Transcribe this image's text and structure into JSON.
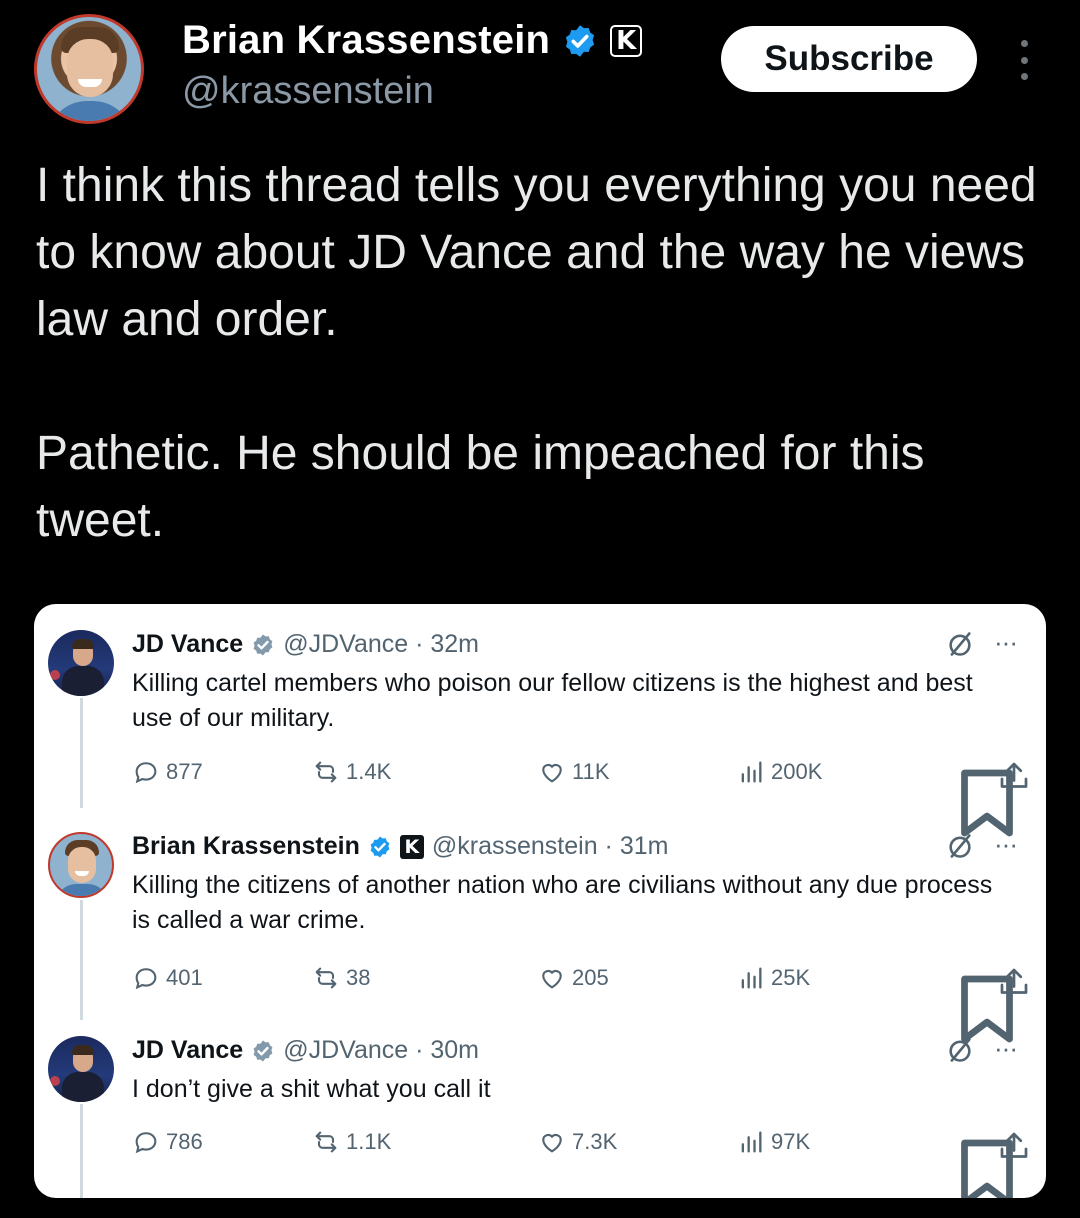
{
  "author": {
    "display_name": "Brian Krassenstein",
    "handle": "@krassenstein",
    "affiliate_badge": "K"
  },
  "subscribe_label": "Subscribe",
  "post": {
    "paragraph_1": "I think this thread tells you everything you need to know about JD Vance and the way he views law and order.",
    "paragraph_2": "Pathetic.  He should be impeached for this tweet."
  },
  "embedded_thread": {
    "tweets": [
      {
        "name": "JD Vance",
        "handle_time": "@JDVance · 32m",
        "text": "Killing cartel members who poison our fellow citizens is the highest and best use of our military.",
        "replies": "877",
        "retweets": "1.4K",
        "likes": "11K",
        "views": "200K"
      },
      {
        "name": "Brian Krassenstein",
        "badge": "K",
        "handle_time": "@krassenstein · 31m",
        "text": "Killing the citizens of another nation who are civilians without any due process is called a war crime.",
        "replies": "401",
        "retweets": "38",
        "likes": "205",
        "views": "25K"
      },
      {
        "name": "JD Vance",
        "handle_time": "@JDVance · 30m",
        "text": "I don’t give a shit what you call it",
        "replies": "786",
        "retweets": "1.1K",
        "likes": "7.3K",
        "views": "97K"
      }
    ]
  },
  "colors": {
    "background": "#000000",
    "verified_blue": "#1d9bf0",
    "muted_text": "#536471",
    "avatar_ring": "#c0392b"
  },
  "icons": [
    "verified-icon",
    "affiliate-badge-icon",
    "more-vertical-icon",
    "grok-icon",
    "more-horizontal-icon",
    "reply-icon",
    "retweet-icon",
    "like-icon",
    "views-icon",
    "bookmark-icon",
    "share-icon"
  ]
}
